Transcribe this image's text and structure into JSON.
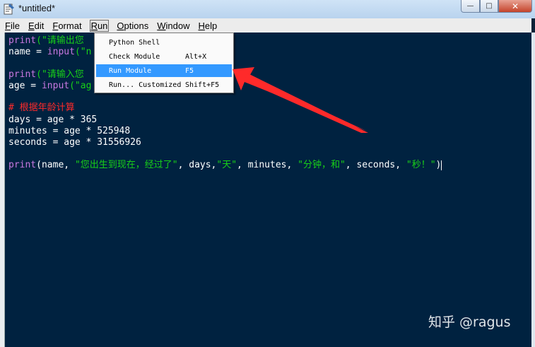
{
  "window": {
    "title": "*untitled*",
    "app_icon": "idle-icon"
  },
  "window_controls": {
    "minimize": "—",
    "maximize": "□",
    "close": "✕"
  },
  "menubar": {
    "items": [
      {
        "label": "File",
        "accel": "F",
        "rest": "ile"
      },
      {
        "label": "Edit",
        "accel": "E",
        "rest": "dit"
      },
      {
        "label": "Format",
        "accel": "F",
        "rest": "ormat",
        "prefix": ""
      },
      {
        "label": "Run",
        "accel": "R",
        "rest": "un"
      },
      {
        "label": "Options",
        "accel": "O",
        "rest": "ptions"
      },
      {
        "label": "Window",
        "accel": "W",
        "rest": "indow"
      },
      {
        "label": "Help",
        "accel": "H",
        "rest": "elp"
      }
    ]
  },
  "run_menu": {
    "items": [
      {
        "label": "Python Shell",
        "shortcut": ""
      },
      {
        "label": "Check Module",
        "shortcut": "Alt+X"
      },
      {
        "label": "Run Module",
        "shortcut": "F5",
        "selected": true
      },
      {
        "label": "Run... Customized",
        "shortcut": "Shift+F5"
      }
    ]
  },
  "editor": {
    "line1_kw": "print",
    "line1_str": "(\"请输出您",
    "line2_a": "name = ",
    "line2_kw": "input",
    "line2_str": "(\"n",
    "line4_kw": "print",
    "line4_str": "(\"请输入您",
    "line5_a": "age = ",
    "line5_kw": "input",
    "line5_str": "(\"ag",
    "comment": "# 根据年龄计算",
    "days_line": "days = age * 365",
    "minutes_line": "minutes = age * 525948",
    "seconds_line": "seconds = age * 31556926",
    "print_kw": "print",
    "print_p1": "(name, ",
    "print_s1": "\"您出生到现在，经过了\"",
    "print_p2": ", days,",
    "print_s2": "\"天\"",
    "print_p3": ", minutes, ",
    "print_s3": "\"分钟，和\"",
    "print_p4": ", seconds, ",
    "print_s4": "\"秒！\"",
    "print_p5": ")"
  },
  "colors": {
    "editor_bg": "#002240",
    "keyword": "#c878e0",
    "string": "#18d018",
    "comment": "#ff2a2a",
    "arrow": "#ff2a2a",
    "selection": "#3399ff"
  },
  "watermark": "知乎 @ragus"
}
